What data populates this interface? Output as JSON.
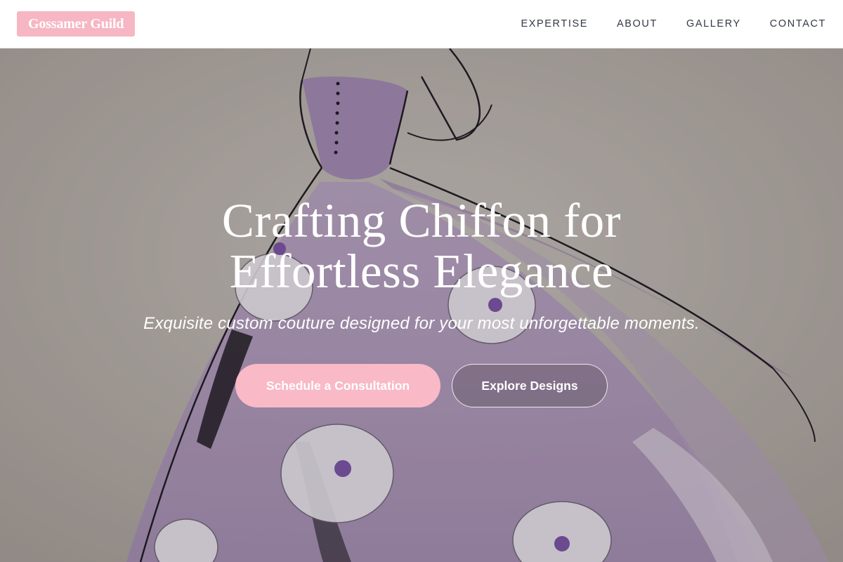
{
  "header": {
    "logo_text": "Gossamer Guild",
    "nav": [
      {
        "label": "EXPERTISE"
      },
      {
        "label": "ABOUT"
      },
      {
        "label": "GALLERY"
      },
      {
        "label": "CONTACT"
      }
    ]
  },
  "hero": {
    "title_line1": "Crafting Chiffon for",
    "title_line2": "Effortless Elegance",
    "subtitle": "Exquisite custom couture designed for your most unforgettable moments.",
    "primary_button": "Schedule a Consultation",
    "secondary_button": "Explore Designs",
    "background_image": "sketch-of-lilac-ball-gown-with-white-roses"
  },
  "colors": {
    "accent_pink": "#f7b6c3",
    "nav_text": "#333845",
    "gown_lilac": "#b7a0c4"
  }
}
